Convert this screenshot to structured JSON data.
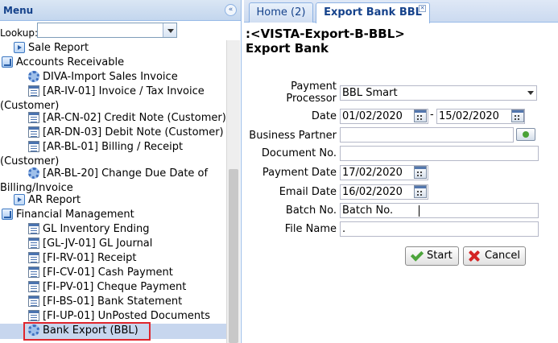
{
  "menu": {
    "title": "Menu",
    "collapse_icon": "double-chevron-left-icon",
    "lookup_label": "Lookup:",
    "lookup_value": ""
  },
  "tree": [
    {
      "label": "Sale Report",
      "icon": "report-icon"
    },
    {
      "label": "Accounts Receivable",
      "icon": "folder-icon"
    },
    {
      "label": "DIVA-Import Sales Invoice",
      "icon": "process-gear-icon"
    },
    {
      "label": "[AR-IV-01] Invoice / Tax Invoice",
      "cont": "(Customer)",
      "icon": "window-icon"
    },
    {
      "label": "[AR-CN-02] Credit Note (Customer)",
      "icon": "window-icon"
    },
    {
      "label": "[AR-DN-03] Debit Note (Customer)",
      "icon": "window-icon"
    },
    {
      "label": "[AR-BL-01] Billing / Receipt",
      "cont": "(Customer)",
      "icon": "window-icon"
    },
    {
      "label": "[AR-BL-20] Change Due Date of",
      "cont": "Billing/Invoice",
      "icon": "process-gear-icon"
    },
    {
      "label": "AR Report",
      "icon": "report-icon"
    },
    {
      "label": "Financial Management",
      "icon": "folder-icon"
    },
    {
      "label": "GL Inventory Ending",
      "icon": "window-icon"
    },
    {
      "label": "[GL-JV-01] GL Journal",
      "icon": "window-icon"
    },
    {
      "label": "[FI-RV-01] Receipt",
      "icon": "window-icon"
    },
    {
      "label": "[FI-CV-01] Cash Payment",
      "icon": "window-icon"
    },
    {
      "label": "[FI-PV-01] Cheque Payment",
      "icon": "window-icon"
    },
    {
      "label": "[FI-BS-01] Bank Statement",
      "icon": "window-icon"
    },
    {
      "label": "[FI-UP-01] UnPosted Documents",
      "icon": "window-icon"
    },
    {
      "label": "Bank Export (BBL)",
      "icon": "process-gear-icon"
    }
  ],
  "tabs": {
    "home": "Home (2)",
    "export": "Export Bank BBL",
    "close_icon": "close-icon"
  },
  "form": {
    "title": ":<VISTA-Export-B-BBL>",
    "subtitle": "Export Bank",
    "payment_processor_label_1": "Payment",
    "payment_processor_label_2": "Processor",
    "payment_processor_value": "BBL Smart",
    "date_label": "Date",
    "date_from": "01/02/2020",
    "date_sep": "-",
    "date_to": "15/02/2020",
    "business_partner_label": "Business Partner",
    "business_partner_value": "",
    "document_no_label": "Document No.",
    "document_no_value": "",
    "payment_date_label": "Payment Date",
    "payment_date_value": "17/02/2020",
    "email_date_label": "Email Date",
    "email_date_value": "16/02/2020",
    "batch_no_label": "Batch No.",
    "batch_no_value": "Batch No.",
    "file_name_label": "File Name",
    "file_name_value": ".",
    "start_label": "Start",
    "cancel_label": "Cancel"
  },
  "colors": {
    "selected_outline": "#e0262d",
    "selected_row": "#c7d6ee",
    "accent": "#15428b"
  }
}
